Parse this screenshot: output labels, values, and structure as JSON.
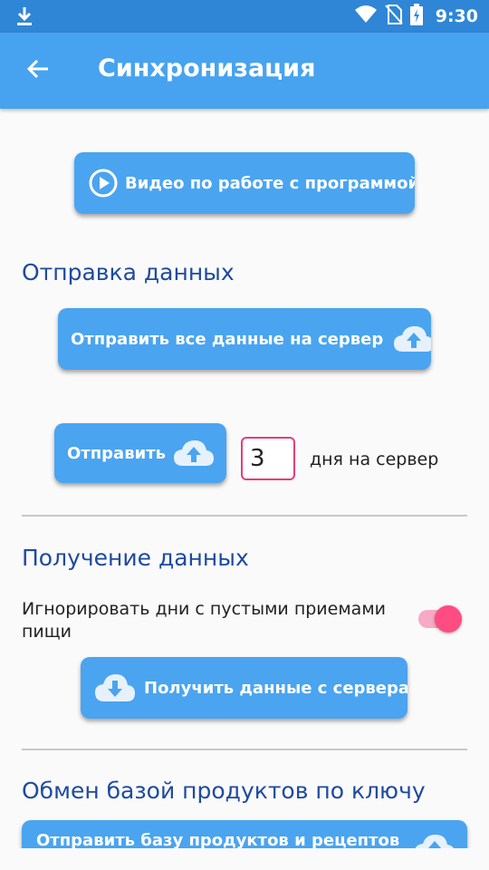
{
  "status": {
    "time": "9:30"
  },
  "appbar": {
    "title": "Синхронизация"
  },
  "video_button": {
    "label": "Видео по работе с программой"
  },
  "send_section": {
    "title": "Отправка данных",
    "send_all_label": "Отправить все данные на сервер",
    "send_label": "Отправить",
    "days_value": "3",
    "days_suffix": "дня на сервер"
  },
  "receive_section": {
    "title": "Получение данных",
    "ignore_label": "Игнорировать дни с пустыми приемами пищи",
    "ignore_enabled": true,
    "get_label": "Получить данные с сервера"
  },
  "exchange_section": {
    "title": "Обмен базой продуктов по ключу",
    "send_base_label": "Отправить базу продуктов и рецептов"
  },
  "colors": {
    "statusbar": "#2f86d6",
    "appbar": "#47a3ef",
    "button": "#4aa4f0",
    "section_title": "#1f4aa0",
    "accent": "#ff4c82"
  }
}
